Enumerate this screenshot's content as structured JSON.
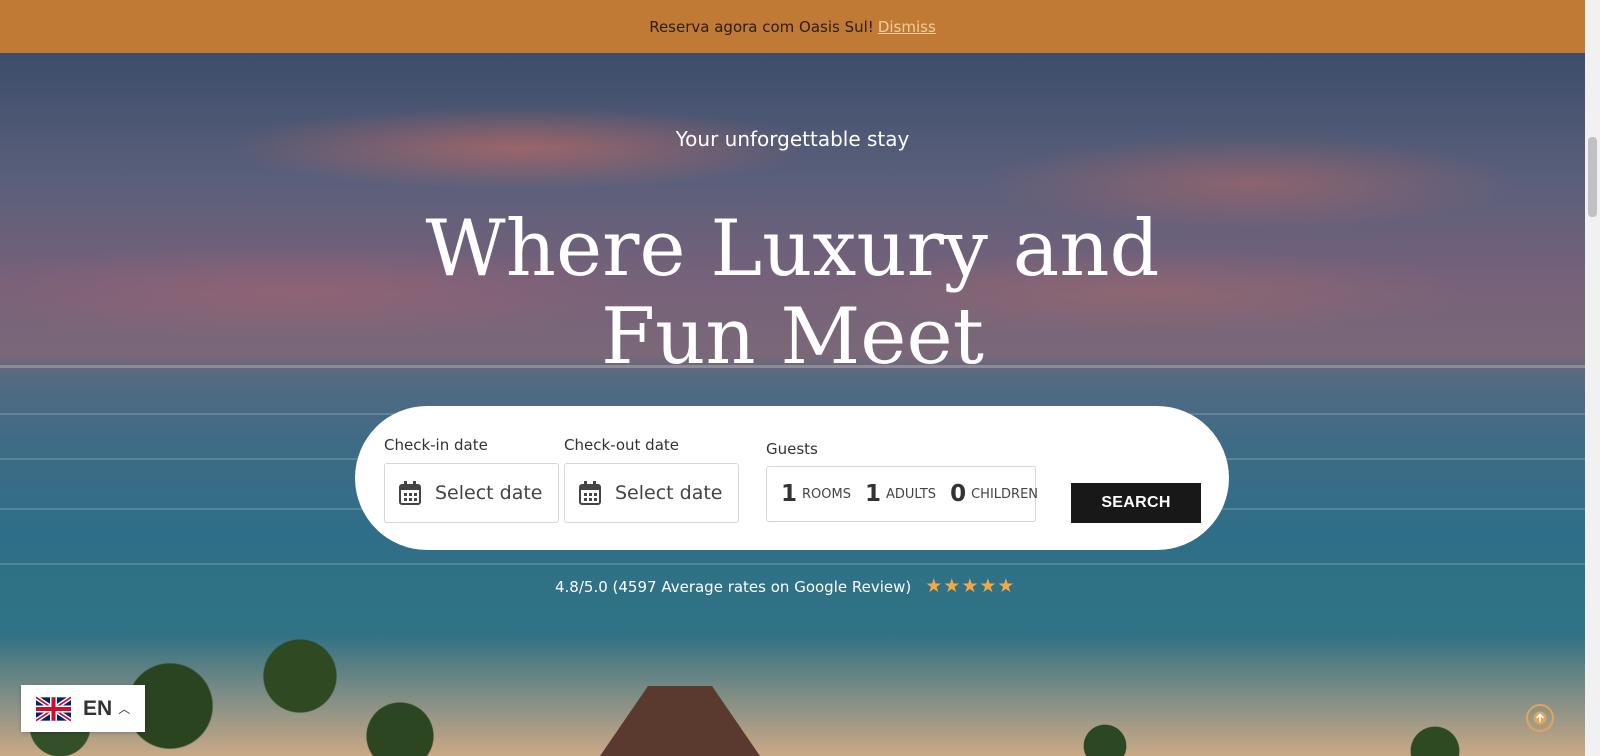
{
  "announcement": {
    "text": "Reserva agora com Oasis Sul!",
    "dismiss_label": "Dismiss"
  },
  "hero": {
    "tagline": "Your unforgettable stay",
    "headline": "Where Luxury and Fun Meet"
  },
  "booking": {
    "checkin_label": "Check-in date",
    "checkin_placeholder": "Select date",
    "checkout_label": "Check-out date",
    "checkout_placeholder": "Select date",
    "guests_label": "Guests",
    "rooms_count": "1",
    "rooms_label": "ROOMS",
    "adults_count": "1",
    "adults_label": "ADULTS",
    "children_count": "0",
    "children_label": "CHILDREN",
    "search_label": "SEARCH"
  },
  "rating": {
    "text": "4.8/5.0 (4597 Average rates on Google Review)",
    "stars": 5,
    "star_color": "#f5a742"
  },
  "language": {
    "code": "EN",
    "flag_icon": "uk-flag-icon",
    "caret_icon": "chevron-up-icon"
  },
  "colors": {
    "announcement_bg": "#c17a35",
    "dismiss_link": "#f2cf9a",
    "search_button_bg": "#181818",
    "scroll_top_ring": "#e0a55a"
  }
}
